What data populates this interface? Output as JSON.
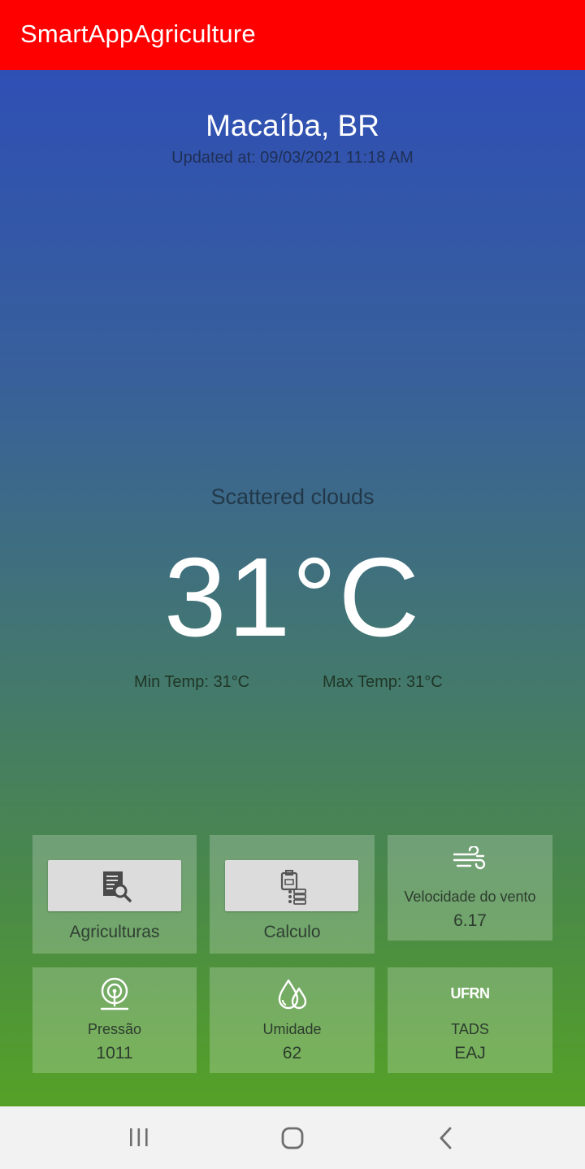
{
  "app": {
    "title": "SmartAppAgriculture",
    "accent": "#ff0000"
  },
  "location": {
    "city": "Macaíba, BR",
    "updated": "Updated at: 09/03/2021 11:18 AM"
  },
  "weather": {
    "status": "Scattered clouds",
    "temperature": "31°C",
    "min_temp": "Min Temp: 31°C",
    "max_temp": "Max Temp: 31°C"
  },
  "cards": {
    "agriculturas": {
      "label": "Agriculturas",
      "icon": "document-search-icon"
    },
    "calculo": {
      "label": "Calculo",
      "icon": "clipboard-list-icon"
    },
    "wind": {
      "label": "Velocidade do vento",
      "value": "6.17",
      "icon": "wind-icon"
    },
    "pressure": {
      "label": "Pressão",
      "value": "1011",
      "icon": "pressure-icon"
    },
    "humidity": {
      "label": "Umidade",
      "value": "62",
      "icon": "humidity-drops-icon"
    },
    "tads": {
      "logo": "UFRN",
      "label": "TADS",
      "value": "EAJ"
    }
  },
  "navigation": {
    "recents": "recents-icon",
    "home": "home-icon",
    "back": "back-icon"
  }
}
